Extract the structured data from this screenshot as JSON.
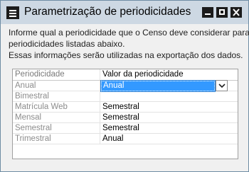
{
  "window": {
    "title": "Parametrização de periodicidades"
  },
  "description": {
    "line1": "Informe qual a periodicidade que o Censo deve considerar para as",
    "line2": "periodicidades listadas abaixo.",
    "line3": "Essas informações serão utilizadas na exportação dos dados."
  },
  "grid": {
    "headers": [
      "Periodicidade",
      "Valor da periodicidade"
    ],
    "rows": [
      {
        "periodicidade": "Anual",
        "valor": "Anual"
      },
      {
        "periodicidade": "Bimestral",
        "valor": ""
      },
      {
        "periodicidade": "Matrícula Web",
        "valor": "Semestral"
      },
      {
        "periodicidade": "Mensal",
        "valor": "Semestral"
      },
      {
        "periodicidade": "Semestral",
        "valor": "Semestral"
      },
      {
        "periodicidade": "Trimestral",
        "valor": "Anual"
      }
    ],
    "selected_row": 0
  },
  "icons": {
    "app": "app-icon",
    "minimize": "minimize-icon",
    "maximize": "maximize-icon",
    "close": "close-icon",
    "dropdown": "chevron-down-icon"
  },
  "colors": {
    "titlebar": "#cdd8e3",
    "selection": "#3399ff",
    "window_bg": "#f0f0f0"
  }
}
